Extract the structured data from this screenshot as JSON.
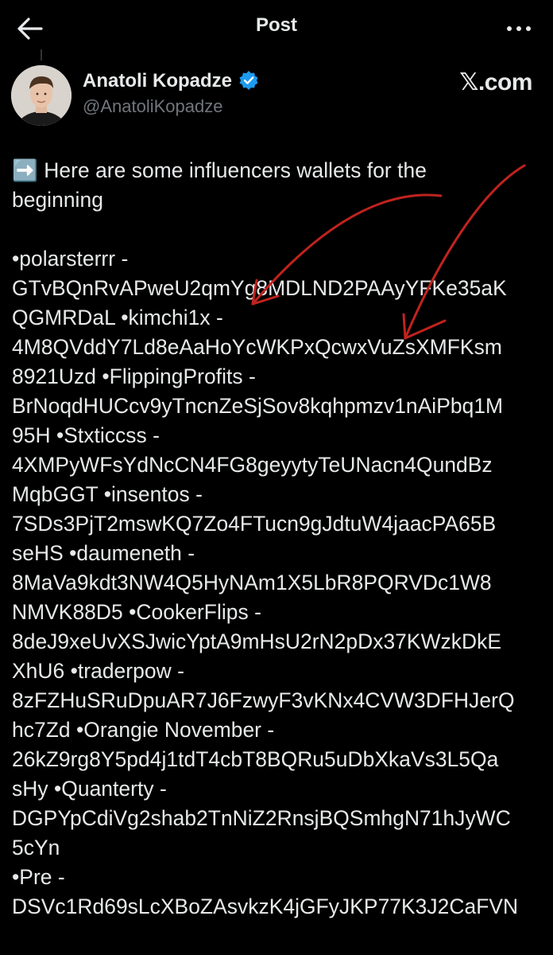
{
  "header": {
    "title": "Post",
    "back_icon": "arrow-left-icon",
    "more_icon": "more-horizontal-icon"
  },
  "author": {
    "name": "Anatoli Kopadze",
    "handle": "@AnatoliKopadze",
    "verified_icon": "verified-badge-icon",
    "verified_color": "#1d9bf0"
  },
  "watermark": {
    "text": "𝕏.com"
  },
  "post": {
    "lines": [
      "➡️ Here are some influencers wallets for the",
      "beginning",
      "",
      "•polarsterrr  -",
      "GTvBQnRvAPweU2qmYg8MDLND2PAAyYFKe35aK",
      "QGMRDaL •kimchi1x -",
      "4M8QVddY7Ld8eAaHoYcWKPxQcwxVuZsXMFKsm",
      "8921Uzd •FlippingProfits -",
      "BrNoqdHUCcv9yTncnZeSjSov8kqhpmzv1nAiPbq1M",
      "95H •Stxticcss -",
      "4XMPyWFsYdNcCN4FG8geyytyTeUNacn4QundBz",
      "MqbGGT •insentos -",
      "7SDs3PjT2mswKQ7Zo4FTucn9gJdtuW4jaacPA65B",
      "seHS •daumeneth -",
      "8MaVa9kdt3NW4Q5HyNAm1X5LbR8PQRVDc1W8",
      "NMVK88D5 •CookerFlips -",
      "8deJ9xeUvXSJwicYptA9mHsU2rN2pDx37KWzkDkE",
      "XhU6 •traderpow -",
      "8zFZHuSRuDpuAR7J6FzwyF3vKNx4CVW3DFHJerQ",
      "hc7Zd •Orangie November -",
      "26kZ9rg8Y5pd4j1tdT4cbT8BQRu5uDbXkaVs3L5Qa",
      "sHy •Quanterty -",
      "DGPYpCdiVg2shab2TnNiZ2RnsjBQSmhgN71hJyWC",
      "5cYn",
      "•Pre -",
      "DSVc1Rd69sLcXBoZAsvkzK4jGFyJKP77K3J2CaFVN"
    ]
  },
  "annotation": {
    "color": "#c0231e"
  }
}
